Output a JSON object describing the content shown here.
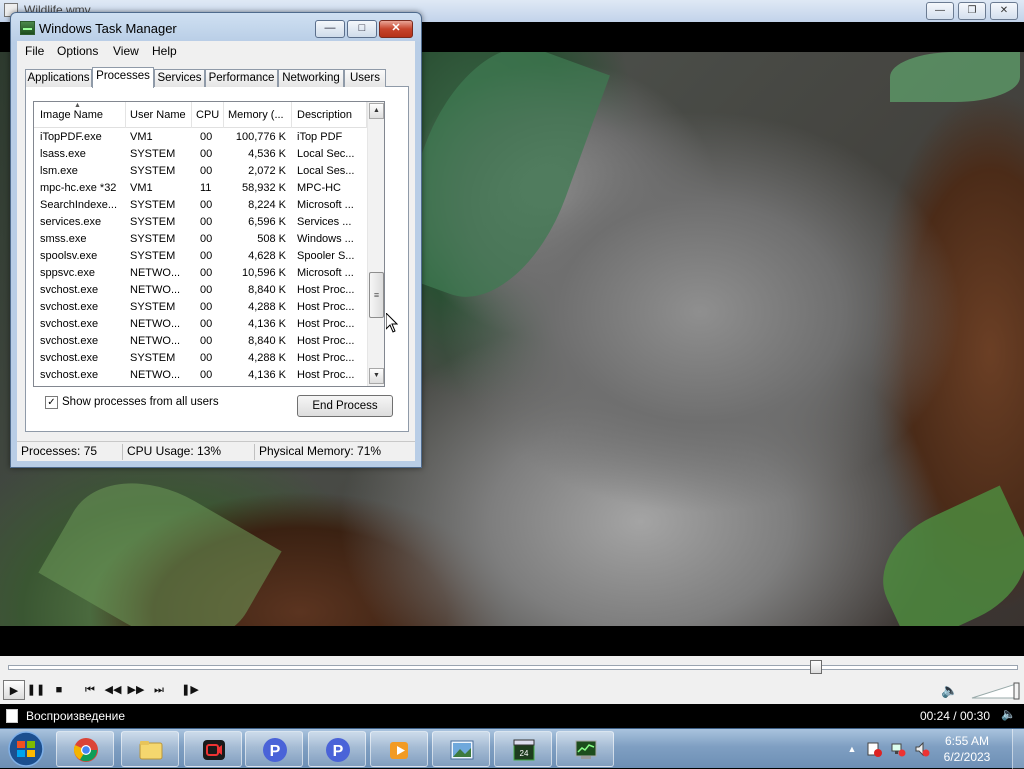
{
  "player": {
    "title": "Wildlife.wmv",
    "window_buttons": {
      "minimize": "—",
      "maximize": "❐",
      "close": "✕"
    },
    "seek_progress": 0.8,
    "controls": {
      "play": "▶",
      "pause": "❚❚",
      "stop": "■",
      "prev": "⏮",
      "rewind": "◀◀",
      "forward": "▶▶",
      "next": "⏭",
      "frame_step": "❚▶"
    },
    "status": {
      "text": "Воспроизведение",
      "time": "00:24 / 00:30",
      "volume_icon": "🔈"
    }
  },
  "taskmgr": {
    "title": "Windows Task Manager",
    "window_buttons": {
      "minimize": "—",
      "maximize": "□",
      "close": "✕"
    },
    "menu": [
      "File",
      "Options",
      "View",
      "Help"
    ],
    "tabs": [
      "Applications",
      "Processes",
      "Services",
      "Performance",
      "Networking",
      "Users"
    ],
    "active_tab": "Processes",
    "columns": [
      "Image Name",
      "User Name",
      "CPU",
      "Memory (...",
      "Description"
    ],
    "sort_indicator": "▲",
    "rows": [
      {
        "name": "iTopPDF.exe",
        "user": "VM1",
        "cpu": "00",
        "mem": "100,776 K",
        "desc": "iTop PDF"
      },
      {
        "name": "lsass.exe",
        "user": "SYSTEM",
        "cpu": "00",
        "mem": "4,536 K",
        "desc": "Local Sec..."
      },
      {
        "name": "lsm.exe",
        "user": "SYSTEM",
        "cpu": "00",
        "mem": "2,072 K",
        "desc": "Local Ses..."
      },
      {
        "name": "mpc-hc.exe *32",
        "user": "VM1",
        "cpu": "11",
        "mem": "58,932 K",
        "desc": "MPC-HC"
      },
      {
        "name": "SearchIndexe...",
        "user": "SYSTEM",
        "cpu": "00",
        "mem": "8,224 K",
        "desc": "Microsoft ..."
      },
      {
        "name": "services.exe",
        "user": "SYSTEM",
        "cpu": "00",
        "mem": "6,596 K",
        "desc": "Services ..."
      },
      {
        "name": "smss.exe",
        "user": "SYSTEM",
        "cpu": "00",
        "mem": "508 K",
        "desc": "Windows ..."
      },
      {
        "name": "spoolsv.exe",
        "user": "SYSTEM",
        "cpu": "00",
        "mem": "4,628 K",
        "desc": "Spooler S..."
      },
      {
        "name": "sppsvc.exe",
        "user": "NETWO...",
        "cpu": "00",
        "mem": "10,596 K",
        "desc": "Microsoft ..."
      },
      {
        "name": "svchost.exe",
        "user": "NETWO...",
        "cpu": "00",
        "mem": "8,840 K",
        "desc": "Host Proc..."
      },
      {
        "name": "svchost.exe",
        "user": "SYSTEM",
        "cpu": "00",
        "mem": "4,288 K",
        "desc": "Host Proc..."
      },
      {
        "name": "svchost.exe",
        "user": "NETWO...",
        "cpu": "00",
        "mem": "4,136 K",
        "desc": "Host Proc..."
      },
      {
        "name": "svchost.exe",
        "user": "NETWO...",
        "cpu": "00",
        "mem": "8,840 K",
        "desc": "Host Proc..."
      },
      {
        "name": "svchost.exe",
        "user": "SYSTEM",
        "cpu": "00",
        "mem": "4,288 K",
        "desc": "Host Proc..."
      },
      {
        "name": "svchost.exe",
        "user": "NETWO...",
        "cpu": "00",
        "mem": "4,136 K",
        "desc": "Host Proc..."
      }
    ],
    "scroll": {
      "up": "▲",
      "down": "▼",
      "grip": "≡"
    },
    "show_all": {
      "label": "Show processes from all users",
      "checked": "✓"
    },
    "end_process": "End Process",
    "status": {
      "processes": "Processes: 75",
      "cpu": "CPU Usage: 13%",
      "memory": "Physical Memory: 71%"
    }
  },
  "taskbar": {
    "apps": [
      "windows-start",
      "chrome",
      "file-explorer",
      "screen-recorder",
      "pdf-app",
      "pdf-app-2",
      "media-player",
      "photo-viewer",
      "video-editor",
      "task-manager"
    ],
    "tray": {
      "arrow": "▲",
      "clock_time": "6:55 AM",
      "clock_date": "6/2/2023"
    }
  }
}
